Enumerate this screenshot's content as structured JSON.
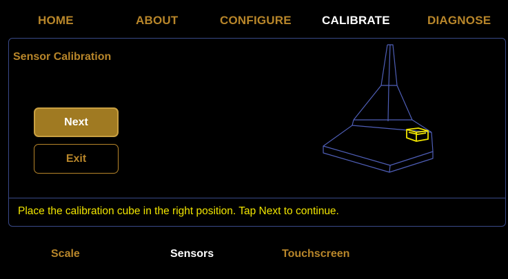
{
  "nav": {
    "items": [
      {
        "label": "HOME"
      },
      {
        "label": "ABOUT"
      },
      {
        "label": "CONFIGURE"
      },
      {
        "label": "CALIBRATE"
      },
      {
        "label": "DIAGNOSE"
      }
    ],
    "active": "CALIBRATE"
  },
  "panel": {
    "title": "Sensor Calibration",
    "next_label": "Next",
    "exit_label": "Exit",
    "status": "Place the calibration cube in the right position. Tap Next to continue.",
    "illustration_icon": "calibration-stand-with-cube"
  },
  "tabs": {
    "items": [
      {
        "label": "Scale"
      },
      {
        "label": "Sensors"
      },
      {
        "label": "Touchscreen"
      }
    ],
    "active": "Sensors"
  },
  "colors": {
    "accent": "#b8862a",
    "active_text": "#ffffff",
    "status_text": "#f2e600",
    "outline": "#3a4a8a",
    "cube": "#f2e600"
  }
}
